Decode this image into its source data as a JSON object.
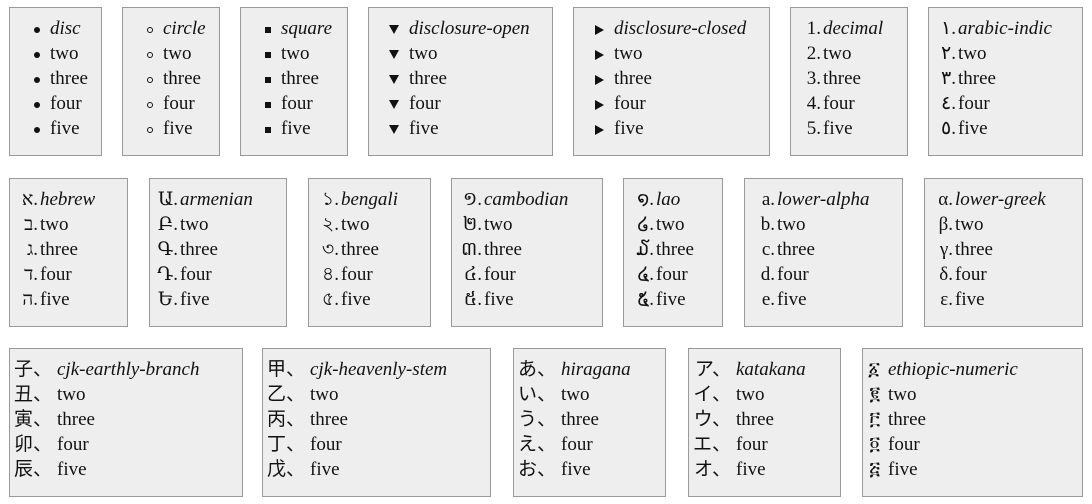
{
  "boxes": [
    {
      "type": "glyph",
      "glyph": "disc",
      "glyph_icon": "disc-bullet-icon",
      "items": [
        "disc",
        "two",
        "three",
        "four",
        "five"
      ]
    },
    {
      "type": "glyph",
      "glyph": "circle",
      "glyph_icon": "circle-bullet-icon",
      "items": [
        "circle",
        "two",
        "three",
        "four",
        "five"
      ]
    },
    {
      "type": "glyph",
      "glyph": "square",
      "glyph_icon": "square-bullet-icon",
      "items": [
        "square",
        "two",
        "three",
        "four",
        "five"
      ]
    },
    {
      "type": "glyph",
      "glyph": "tri-down",
      "glyph_icon": "triangle-down-icon",
      "items": [
        "disclosure-open",
        "two",
        "three",
        "four",
        "five"
      ]
    },
    {
      "type": "glyph",
      "glyph": "tri-right",
      "glyph_icon": "triangle-right-icon",
      "items": [
        "disclosure-closed",
        "two",
        "three",
        "four",
        "five"
      ]
    },
    {
      "type": "text",
      "markers": [
        "1.",
        "2.",
        "3.",
        "4.",
        "5."
      ],
      "items": [
        "decimal",
        "two",
        "three",
        "four",
        "five"
      ]
    },
    {
      "type": "text",
      "markers": [
        "١.",
        "٢.",
        "٣.",
        "٤.",
        "٥."
      ],
      "items": [
        "arabic-indic",
        "two",
        "three",
        "four",
        "five"
      ]
    },
    {
      "type": "text",
      "markers": [
        "א.",
        "ב.",
        "ג.",
        "ד.",
        "ה."
      ],
      "items": [
        "hebrew",
        "two",
        "three",
        "four",
        "five"
      ]
    },
    {
      "type": "text",
      "markers": [
        "Ա.",
        "Բ.",
        "Գ.",
        "Դ.",
        "Ե."
      ],
      "items": [
        "armenian",
        "two",
        "three",
        "four",
        "five"
      ]
    },
    {
      "type": "text",
      "markers": [
        "১.",
        "২.",
        "৩.",
        "৪.",
        "৫."
      ],
      "items": [
        "bengali",
        "two",
        "three",
        "four",
        "five"
      ]
    },
    {
      "type": "text",
      "markers": [
        "១.",
        "២.",
        "៣.",
        "៤.",
        "៥."
      ],
      "items": [
        "cambodian",
        "two",
        "three",
        "four",
        "five"
      ]
    },
    {
      "type": "text",
      "markers": [
        "໑.",
        "໒.",
        "໓.",
        "໔.",
        "໕."
      ],
      "items": [
        "lao",
        "two",
        "three",
        "four",
        "five"
      ]
    },
    {
      "type": "text",
      "markers": [
        "a.",
        "b.",
        "c.",
        "d.",
        "e."
      ],
      "items": [
        "lower-alpha",
        "two",
        "three",
        "four",
        "five"
      ]
    },
    {
      "type": "text",
      "markers": [
        "α.",
        "β.",
        "γ.",
        "δ.",
        "ε."
      ],
      "items": [
        "lower-greek",
        "two",
        "three",
        "four",
        "five"
      ]
    },
    {
      "type": "text",
      "markers": [
        "子、",
        "丑、",
        "寅、",
        "卯、",
        "辰、"
      ],
      "items": [
        "cjk-earthly-branch",
        "two",
        "three",
        "four",
        "five"
      ]
    },
    {
      "type": "text",
      "markers": [
        "甲、",
        "乙、",
        "丙、",
        "丁、",
        "戊、"
      ],
      "items": [
        "cjk-heavenly-stem",
        "two",
        "three",
        "four",
        "five"
      ]
    },
    {
      "type": "text",
      "markers": [
        "あ、",
        "い、",
        "う、",
        "え、",
        "お、"
      ],
      "items": [
        "hiragana",
        "two",
        "three",
        "four",
        "five"
      ]
    },
    {
      "type": "text",
      "markers": [
        "ア、",
        "イ、",
        "ウ、",
        "エ、",
        "オ、"
      ],
      "items": [
        "katakana",
        "two",
        "three",
        "four",
        "five"
      ]
    },
    {
      "type": "text",
      "markers": [
        "፩",
        "፪",
        "፫",
        "፬",
        "፭"
      ],
      "items": [
        "ethiopic-numeric",
        "two",
        "three",
        "four",
        "five"
      ]
    }
  ]
}
